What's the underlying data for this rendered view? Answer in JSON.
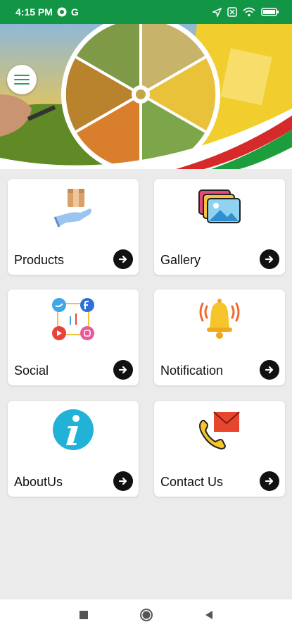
{
  "status_bar": {
    "time": "4:15 PM",
    "g_label": "G"
  },
  "colors": {
    "status_green": "#129545",
    "arrow_button": "#111111",
    "background": "#ebebeb"
  },
  "menu": {
    "icon": "hamburger-menu-icon"
  },
  "cards": [
    {
      "label": "Products",
      "icon": "products-hand-box-icon"
    },
    {
      "label": "Gallery",
      "icon": "gallery-photos-icon"
    },
    {
      "label": "Social",
      "icon": "social-media-icon"
    },
    {
      "label": "Notification",
      "icon": "bell-icon"
    },
    {
      "label": "AboutUs",
      "icon": "info-icon"
    },
    {
      "label": "Contact Us",
      "icon": "phone-mail-icon"
    }
  ],
  "nav": {
    "recents": "square-icon",
    "home": "circle-icon",
    "back": "triangle-back-icon"
  }
}
